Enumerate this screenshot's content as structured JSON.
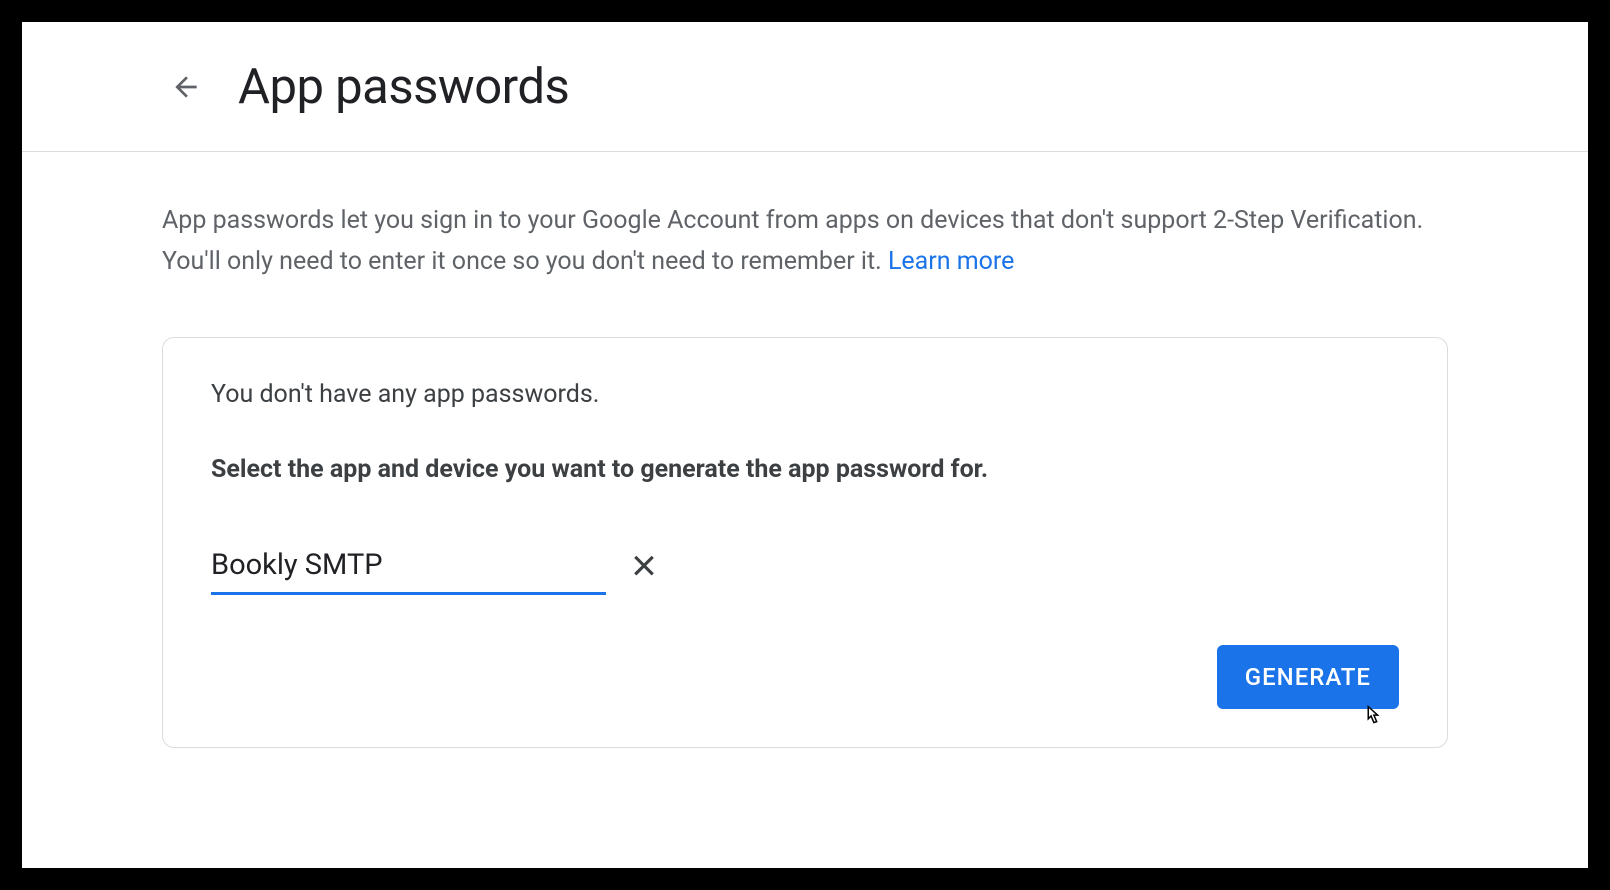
{
  "header": {
    "title": "App passwords"
  },
  "description": {
    "text": "App passwords let you sign in to your Google Account from apps on devices that don't support 2-Step Verification. You'll only need to enter it once so you don't need to remember it. ",
    "learn_more": "Learn more"
  },
  "card": {
    "no_passwords": "You don't have any app passwords.",
    "select_prompt": "Select the app and device you want to generate the app password for.",
    "input_value": "Bookly SMTP",
    "generate_label": "GENERATE"
  }
}
